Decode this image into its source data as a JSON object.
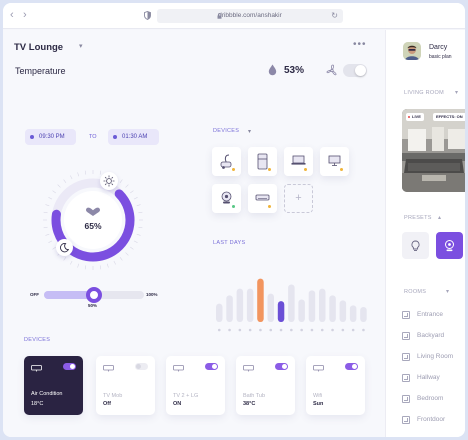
{
  "browser": {
    "url": "dribbble.com/anshakir"
  },
  "header": {
    "title": "TV Lounge",
    "temperature_label": "Temperature",
    "humidity": "53%"
  },
  "schedule": {
    "from": "09:30 PM",
    "to_label": "TO",
    "to": "01:30 AM"
  },
  "dial": {
    "value_text": "65%",
    "level": 0.65
  },
  "slider": {
    "min_label": "OFF",
    "max_label": "100%",
    "value_label": "50%",
    "value": 0.5
  },
  "devices_top": {
    "label": "DEVICES",
    "tiles": [
      {
        "icon": "vacuum-icon",
        "status_color": "#f0b43a"
      },
      {
        "icon": "fridge-icon",
        "status_color": "#f0b43a"
      },
      {
        "icon": "laptop-icon",
        "status_color": "#f0b43a"
      },
      {
        "icon": "monitor-icon",
        "status_color": "#f0b43a"
      },
      {
        "icon": "speaker-icon",
        "status_color": "#57c785"
      },
      {
        "icon": "air-conditioner-icon",
        "status_color": "#f0b43a"
      }
    ]
  },
  "usage": {
    "label": "LAST DAYS"
  },
  "chart_data": {
    "type": "bar",
    "title": "LAST DAYS",
    "values": [
      22,
      32,
      40,
      40,
      52,
      34,
      25,
      45,
      27,
      38,
      40,
      32,
      26,
      20,
      18
    ],
    "highlight": {
      "4": "#f2955f",
      "6": "#6b4fd6"
    },
    "bar_color": "#e5e5ef"
  },
  "devices_bottom": {
    "label": "DEVICES",
    "cards": [
      {
        "name": "Air Condition",
        "state": "18°C",
        "on": true,
        "active": true,
        "icon": "air-conditioner-icon"
      },
      {
        "name": "TV Mob",
        "state": "Off",
        "on": false,
        "active": false,
        "icon": "tv-icon"
      },
      {
        "name": "TV 2 + LG",
        "state": "ON",
        "on": true,
        "active": false,
        "icon": "tv-icon"
      },
      {
        "name": "Bath Tub",
        "state": "38°C",
        "on": true,
        "active": false,
        "icon": "bathtub-icon"
      },
      {
        "name": "Wifi",
        "state": "Sun",
        "on": true,
        "active": false,
        "icon": "router-icon"
      }
    ]
  },
  "sidebar": {
    "user_name": "Darcy",
    "user_plan": "basic plan",
    "living_room_label": "LIVING ROOM",
    "live_badge": "LIVE",
    "effects_badge": "EFFECTS: ON",
    "presets_label": "PRESETS",
    "rooms_label": "ROOMS",
    "rooms": [
      "Entrance",
      "Backyard",
      "Living Room",
      "Hallway",
      "Bedroom",
      "Frontdoor"
    ]
  },
  "colors": {
    "accent": "#7b4fe0",
    "accent_light": "#c6bdf5",
    "dark_card": "#2a2342",
    "orange": "#f2955f"
  }
}
